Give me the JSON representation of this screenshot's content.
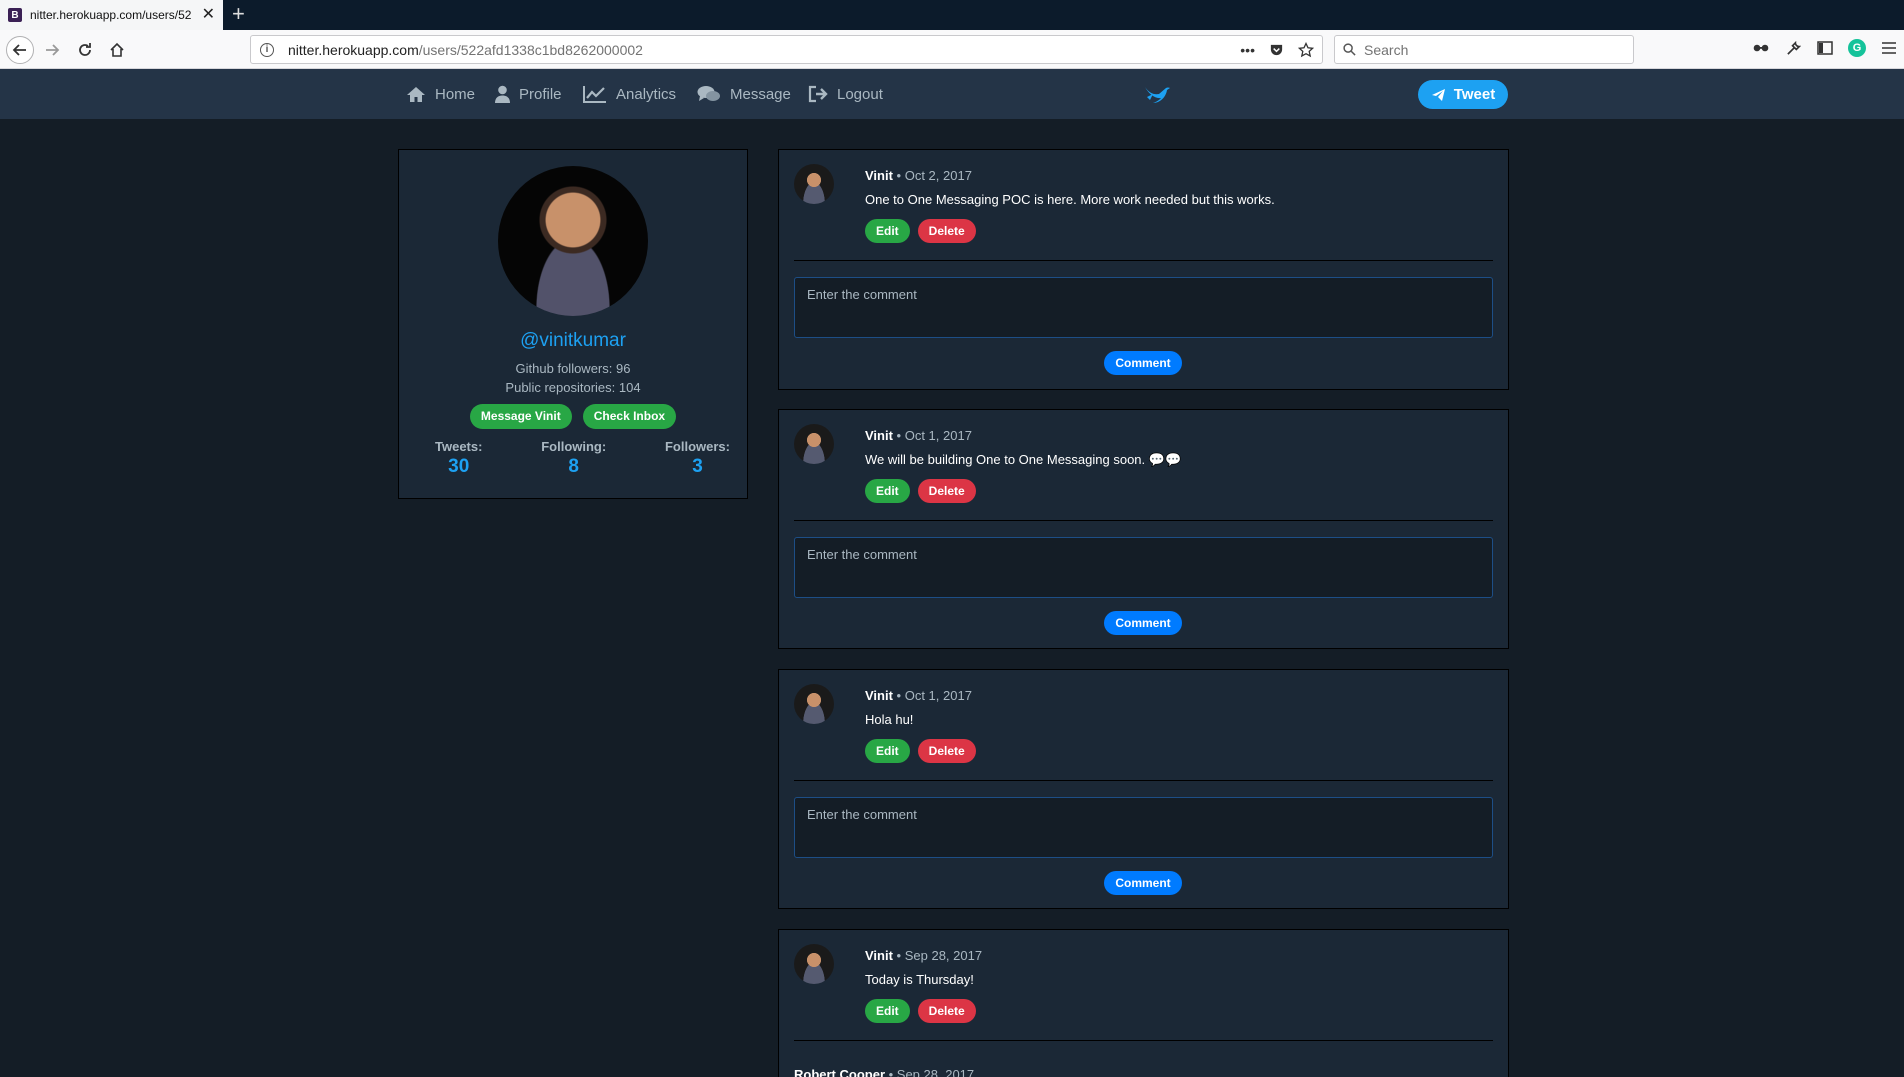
{
  "browser": {
    "tab_title": "nitter.herokuapp.com/users/52",
    "favicon_letter": "B",
    "url_domain": "nitter.herokuapp.com",
    "url_path": "/users/522afd1338c1bd8262000002",
    "search_placeholder": "Search"
  },
  "nav": {
    "home": "Home",
    "profile": "Profile",
    "analytics": "Analytics",
    "message": "Message",
    "logout": "Logout",
    "tweet_button": "Tweet"
  },
  "profile": {
    "handle": "@vinitkumar",
    "github_followers": "Github followers: 96",
    "public_repos": "Public repositories: 104",
    "message_button": "Message Vinit",
    "inbox_button": "Check Inbox",
    "tweets_label": "Tweets:",
    "tweets_count": "30",
    "following_label": "Following:",
    "following_count": "8",
    "followers_label": "Followers:",
    "followers_count": "3"
  },
  "tweets": [
    {
      "author": "Vinit",
      "date": "Oct 2, 2017",
      "text": "One to One Messaging POC is here. More work needed but this works.",
      "edit": "Edit",
      "delete": "Delete",
      "comment_placeholder": "Enter the comment",
      "comment_button": "Comment"
    },
    {
      "author": "Vinit",
      "date": "Oct 1, 2017",
      "text": "We will be building One to One Messaging soon. 💬💬",
      "edit": "Edit",
      "delete": "Delete",
      "comment_placeholder": "Enter the comment",
      "comment_button": "Comment"
    },
    {
      "author": "Vinit",
      "date": "Oct 1, 2017",
      "text": "Hola hu!",
      "edit": "Edit",
      "delete": "Delete",
      "comment_placeholder": "Enter the comment",
      "comment_button": "Comment"
    },
    {
      "author": "Vinit",
      "date": "Sep 28, 2017",
      "text": "Today is Thursday!",
      "edit": "Edit",
      "delete": "Delete",
      "comment_author": "Robert Cooper",
      "comment_date": "Sep 28, 2017"
    }
  ],
  "colors": {
    "background": "#141d26",
    "card": "#1b2836",
    "nav": "#243447",
    "accent": "#1da1f2",
    "success": "#28a745",
    "danger": "#dc3545",
    "primary": "#007bff"
  },
  "icons": [
    "home-icon",
    "user-icon",
    "chart-line-icon",
    "comments-icon",
    "sign-out-icon",
    "bird-logo-icon",
    "paper-plane-icon"
  ]
}
